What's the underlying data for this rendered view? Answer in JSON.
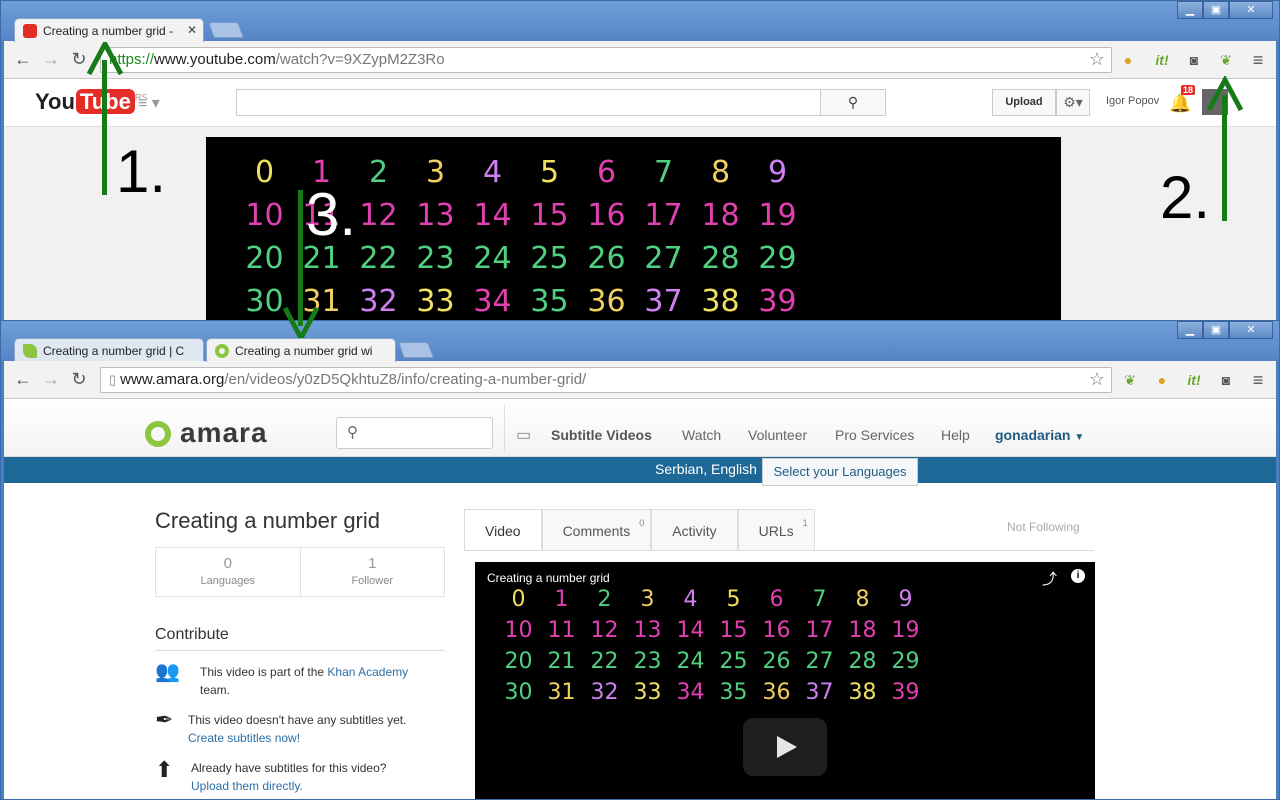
{
  "window1": {
    "tabs": [
      {
        "title": "Creating a number grid - ",
        "icon": "youtube-icon",
        "active": true
      }
    ],
    "url": {
      "scheme": "https://",
      "host": "www.youtube.com",
      "path": "/watch?v=9XZypM2Z3Ro"
    },
    "youtube": {
      "logo_text": "You",
      "logo_tube": "Tube",
      "logo_suffix": "RS",
      "upload_label": "Upload",
      "user_name": "Igor Popov",
      "notification_count": "18"
    }
  },
  "window2": {
    "tabs": [
      {
        "title": "Creating a number grid | C",
        "icon": "amara-leaf-icon",
        "active": false
      },
      {
        "title": "Creating a number grid wi",
        "icon": "amara-ring-icon",
        "active": true
      }
    ],
    "url": {
      "host": "www.amara.org",
      "path": "/en/videos/y0zD5QkhtuZ8/info/creating-a-number-grid/"
    },
    "amara": {
      "logo_text": "amara",
      "nav": {
        "subtitle_videos": "Subtitle Videos",
        "watch": "Watch",
        "volunteer": "Volunteer",
        "pro_services": "Pro Services",
        "help": "Help",
        "user": "gonadarian"
      },
      "languages_bar": {
        "languages": "Serbian, English",
        "select_label": "Select your Languages"
      },
      "video_title": "Creating a number grid",
      "stats": [
        {
          "value": "0",
          "label": "Languages"
        },
        {
          "value": "1",
          "label": "Follower"
        }
      ],
      "contribute": {
        "heading": "Contribute",
        "part_of_prefix": "This video is part of the ",
        "team_link": "Khan Academy",
        "part_of_suffix": "team.",
        "no_subtitles": "This video doesn't have any subtitles yet.",
        "create_link": "Create subtitles now!",
        "already_have": "Already have subtitles for this video?",
        "upload_link": "Upload them directly."
      },
      "tabs": [
        {
          "label": "Video",
          "count": ""
        },
        {
          "label": "Comments",
          "count": "0"
        },
        {
          "label": "Activity",
          "count": ""
        },
        {
          "label": "URLs",
          "count": "1"
        }
      ],
      "follow_status": "Not Following",
      "player_title": "Creating a number grid"
    }
  },
  "number_grid": {
    "rows": [
      {
        "color": "#f0e060",
        "numbers": [
          "0",
          "1",
          "2",
          "3",
          "4",
          "5",
          "6",
          "7",
          "8",
          "9"
        ]
      },
      {
        "color": "#e040b0",
        "numbers": [
          "10",
          "11",
          "12",
          "13",
          "14",
          "15",
          "16",
          "17",
          "18",
          "19"
        ]
      },
      {
        "color": "#50d080",
        "numbers": [
          "20",
          "21",
          "22",
          "23",
          "24",
          "25",
          "26",
          "27",
          "28",
          "29"
        ]
      },
      {
        "color": "#f0d060",
        "numbers": [
          "30",
          "31",
          "32",
          "33",
          "34",
          "35",
          "36",
          "37",
          "38",
          "39"
        ]
      }
    ],
    "alt_row_colors": [
      "#f0e060",
      "#e040b0",
      "#50d080",
      "#f0d060",
      "#d080f0"
    ]
  },
  "annotations": {
    "one": "1.",
    "two": "2.",
    "three": "3."
  },
  "colors": {
    "arrow": "#167a16",
    "amara_blue": "#1d6897",
    "amara_green": "#8cc63f",
    "youtube_red": "#e52d27"
  }
}
